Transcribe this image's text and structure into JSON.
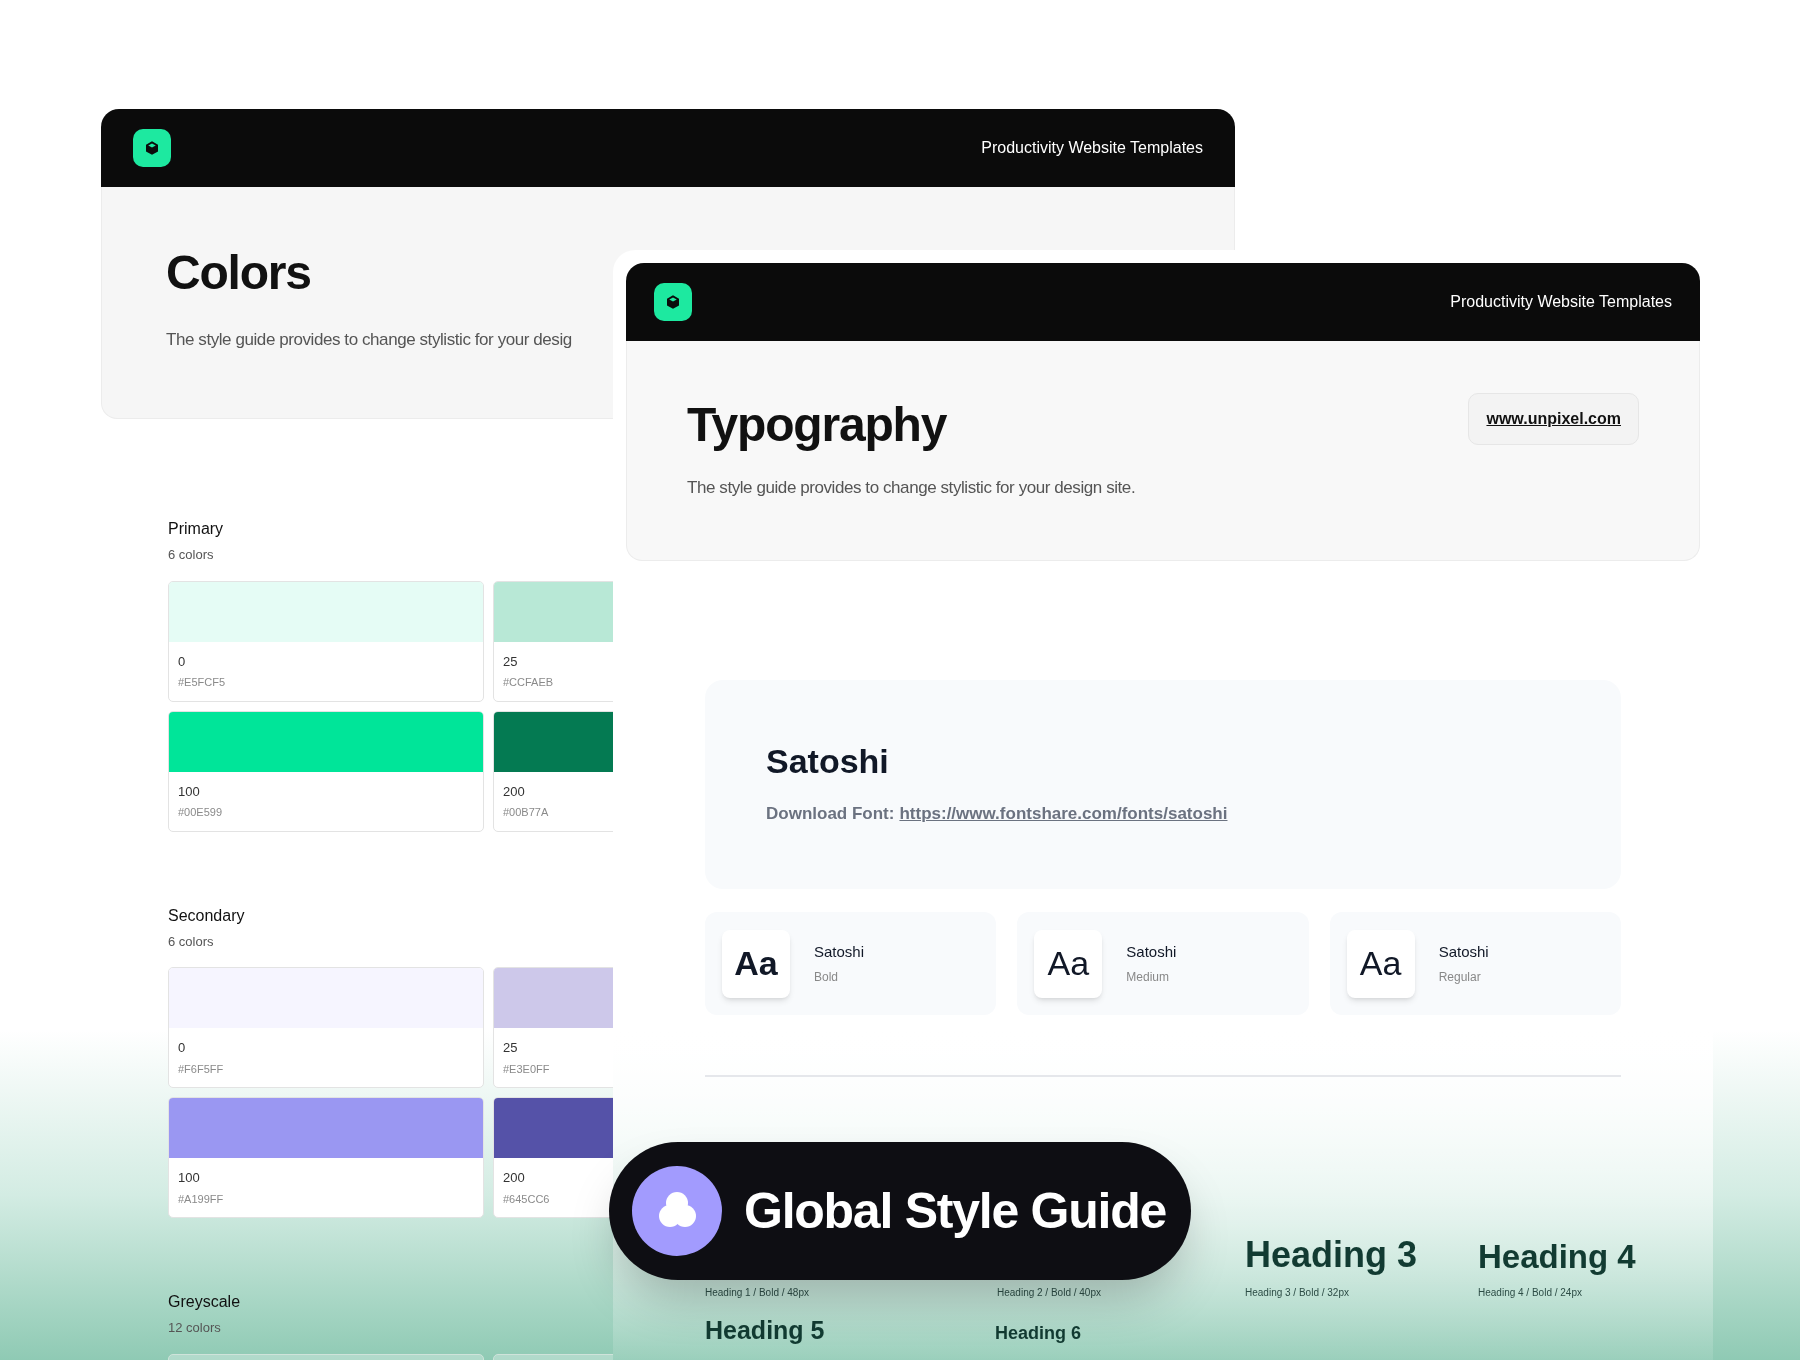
{
  "back_window": {
    "header": {
      "title": "Productivity Website Templates"
    },
    "hero": {
      "title": "Colors",
      "description": "The style guide provides to change stylistic for your desig"
    },
    "palettes": [
      {
        "name": "Primary",
        "count": "6 colors",
        "swatches": [
          {
            "label": "0",
            "hex": "#E5FCF5",
            "color": "#e5fcf5"
          },
          {
            "label": "25",
            "hex": "#CCFAEB",
            "color": "#b8e8d6"
          },
          {
            "label": "100",
            "hex": "#00E599",
            "color": "#00e599"
          },
          {
            "label": "200",
            "hex": "#00B77A",
            "color": "#047a52"
          }
        ]
      },
      {
        "name": "Secondary",
        "count": "6 colors",
        "swatches": [
          {
            "label": "0",
            "hex": "#F6F5FF",
            "color": "#f6f5ff"
          },
          {
            "label": "25",
            "hex": "#E3E0FF",
            "color": "#cdc8ea"
          },
          {
            "label": "100",
            "hex": "#A199FF",
            "color": "#9a97f2"
          },
          {
            "label": "200",
            "hex": "#645CC6",
            "color": "#5552a8"
          }
        ]
      },
      {
        "name": "Greyscale",
        "count": "12 colors"
      }
    ]
  },
  "front_window": {
    "header": {
      "title": "Productivity Website Templates"
    },
    "hero": {
      "title": "Typography",
      "description": "The style guide provides to change stylistic for your design site.",
      "link": "www.unpixel.com"
    },
    "font": {
      "name": "Satoshi",
      "download_label": "Download Font:",
      "url": "https://www.fontshare.com/fonts/satoshi"
    },
    "weights": [
      {
        "sample": "Aa",
        "family": "Satoshi",
        "weight": "Bold",
        "kind": "bold"
      },
      {
        "sample": "Aa",
        "family": "Satoshi",
        "weight": "Medium",
        "kind": "medium"
      },
      {
        "sample": "Aa",
        "family": "Satoshi",
        "weight": "Regular",
        "kind": "regular"
      }
    ],
    "headings": [
      {
        "spec": "Heading 1 / Bold / 48px"
      },
      {
        "spec": "Heading 2 / Bold / 40px"
      },
      {
        "title": "Heading 3",
        "spec": "Heading 3 / Bold / 32px"
      },
      {
        "title": "Heading 4",
        "spec": "Heading 4 / Bold / 24px"
      }
    ],
    "headings_more": [
      {
        "title": "Heading 5"
      },
      {
        "title": "Heading 6"
      }
    ]
  },
  "badge": {
    "label": "Global Style Guide"
  }
}
